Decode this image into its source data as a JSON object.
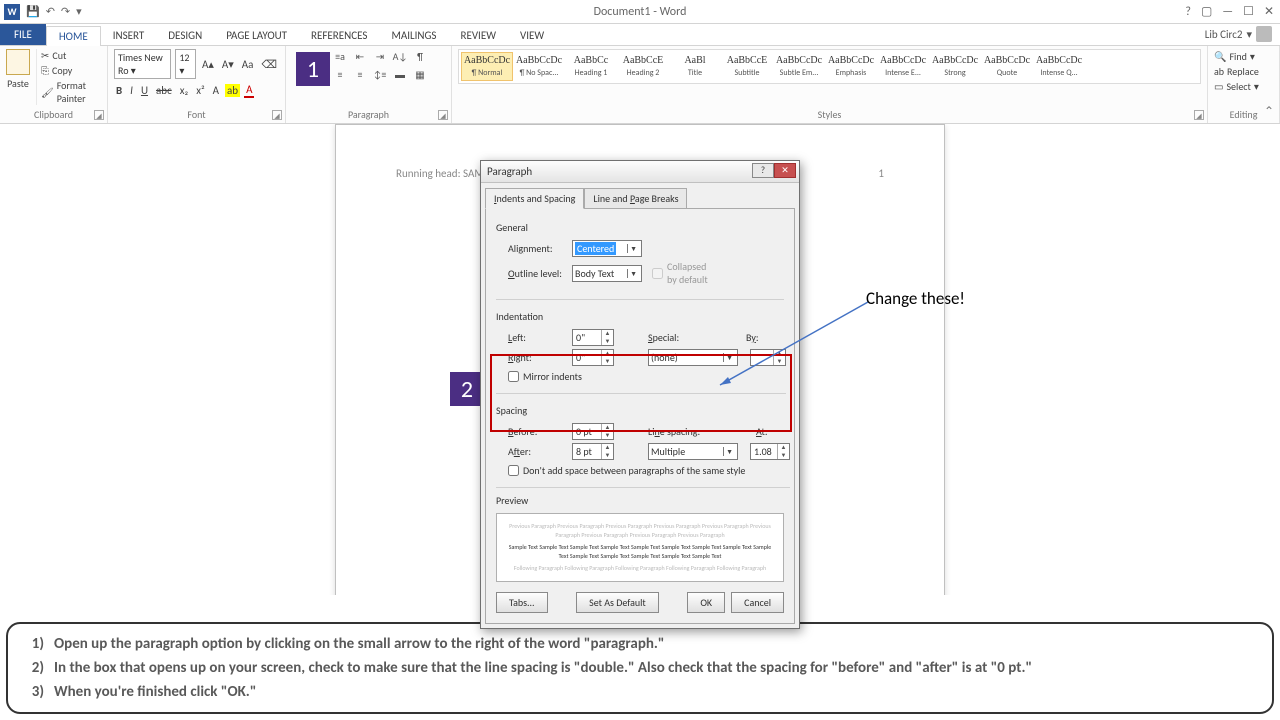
{
  "title": "Document1 - Word",
  "user": "Lib Circ2",
  "qat": {
    "save": "💾",
    "undo": "↶",
    "redo": "↷",
    "more": "▾"
  },
  "winbtns": {
    "help": "?",
    "opts": "▢",
    "min": "—",
    "max": "☐",
    "close": "✕"
  },
  "tabs": [
    "FILE",
    "HOME",
    "INSERT",
    "DESIGN",
    "PAGE LAYOUT",
    "REFERENCES",
    "MAILINGS",
    "REVIEW",
    "VIEW"
  ],
  "clipboard": {
    "paste": "Paste",
    "cut": "Cut",
    "copy": "Copy",
    "painter": "Format Painter",
    "label": "Clipboard"
  },
  "font": {
    "name": "Times New Ro",
    "size": "12",
    "grow": "A▴",
    "shrink": "A▾",
    "case": "Aa",
    "clear": "⌫",
    "bold": "B",
    "italic": "I",
    "underline": "U",
    "strike": "abc",
    "sub": "x₂",
    "sup": "x²",
    "effects": "A",
    "highlight": "ab",
    "color": "A",
    "label": "Font"
  },
  "paragraph": {
    "label": "Paragraph"
  },
  "styles_label": "Styles",
  "styles": [
    {
      "sample": "AaBbCcDc",
      "name": "¶ Normal",
      "sel": true
    },
    {
      "sample": "AaBbCcDc",
      "name": "¶ No Spac..."
    },
    {
      "sample": "AaBbCc",
      "name": "Heading 1"
    },
    {
      "sample": "AaBbCcE",
      "name": "Heading 2"
    },
    {
      "sample": "AaBl",
      "name": "Title"
    },
    {
      "sample": "AaBbCcE",
      "name": "Subtitle"
    },
    {
      "sample": "AaBbCcDc",
      "name": "Subtle Em..."
    },
    {
      "sample": "AaBbCcDc",
      "name": "Emphasis"
    },
    {
      "sample": "AaBbCcDc",
      "name": "Intense E..."
    },
    {
      "sample": "AaBbCcDc",
      "name": "Strong"
    },
    {
      "sample": "AaBbCcDc",
      "name": "Quote"
    },
    {
      "sample": "AaBbCcDc",
      "name": "Intense Q..."
    }
  ],
  "editing": {
    "find": "Find",
    "replace": "Replace",
    "select": "Select",
    "label": "Editing"
  },
  "pagehdr": {
    "left": "Running head: SAMPLE APA PAPER",
    "right": "1"
  },
  "dialog": {
    "title": "Paragraph",
    "tab1": "Indents and Spacing",
    "tab2": "Line and Page Breaks",
    "general": "General",
    "alignment_lbl": "Alignment:",
    "alignment_val": "Centered",
    "outline_lbl": "Outline level:",
    "outline_val": "Body Text",
    "collapsed": "Collapsed by default",
    "indentation": "Indentation",
    "left_lbl": "Left:",
    "left_val": "0\"",
    "right_lbl": "Right:",
    "right_val": "0\"",
    "special_lbl": "Special:",
    "special_val": "(none)",
    "by_lbl": "By:",
    "by_val": "",
    "mirror": "Mirror indents",
    "spacing": "Spacing",
    "before_lbl": "Before:",
    "before_val": "0 pt",
    "after_lbl": "After:",
    "after_val": "8 pt",
    "linesp_lbl": "Line spacing:",
    "linesp_val": "Multiple",
    "at_lbl": "At:",
    "at_val": "1.08",
    "dontadd": "Don't add space between paragraphs of the same style",
    "preview": "Preview",
    "prev_grey": "Previous Paragraph Previous Paragraph Previous Paragraph Previous Paragraph Previous Paragraph Previous Paragraph Previous Paragraph Previous Paragraph Previous Paragraph",
    "prev_body": "Sample Text Sample Text Sample Text Sample Text Sample Text Sample Text Sample Text Sample Text Sample Text Sample Text Sample Text Sample Text Sample Text Sample Text",
    "prev_foll": "Following Paragraph Following Paragraph Following Paragraph Following Paragraph Following Paragraph",
    "tabs_btn": "Tabs...",
    "default_btn": "Set As Default",
    "ok": "OK",
    "cancel": "Cancel"
  },
  "marker1": "1",
  "marker2": "2",
  "annotation": "Change these!",
  "instructions": {
    "n1": "1)",
    "t1": "Open up the paragraph  option by clicking on the small arrow to the right of the word \"paragraph.\"",
    "n2": "2)",
    "t2": "In the box that opens up on your screen, check to make sure that the line spacing is \"double.\"  Also check that the spacing for \"before\" and \"after\" is at \"0 pt.\"",
    "n3": "3)",
    "t3": "When you're finished click \"OK.\""
  }
}
